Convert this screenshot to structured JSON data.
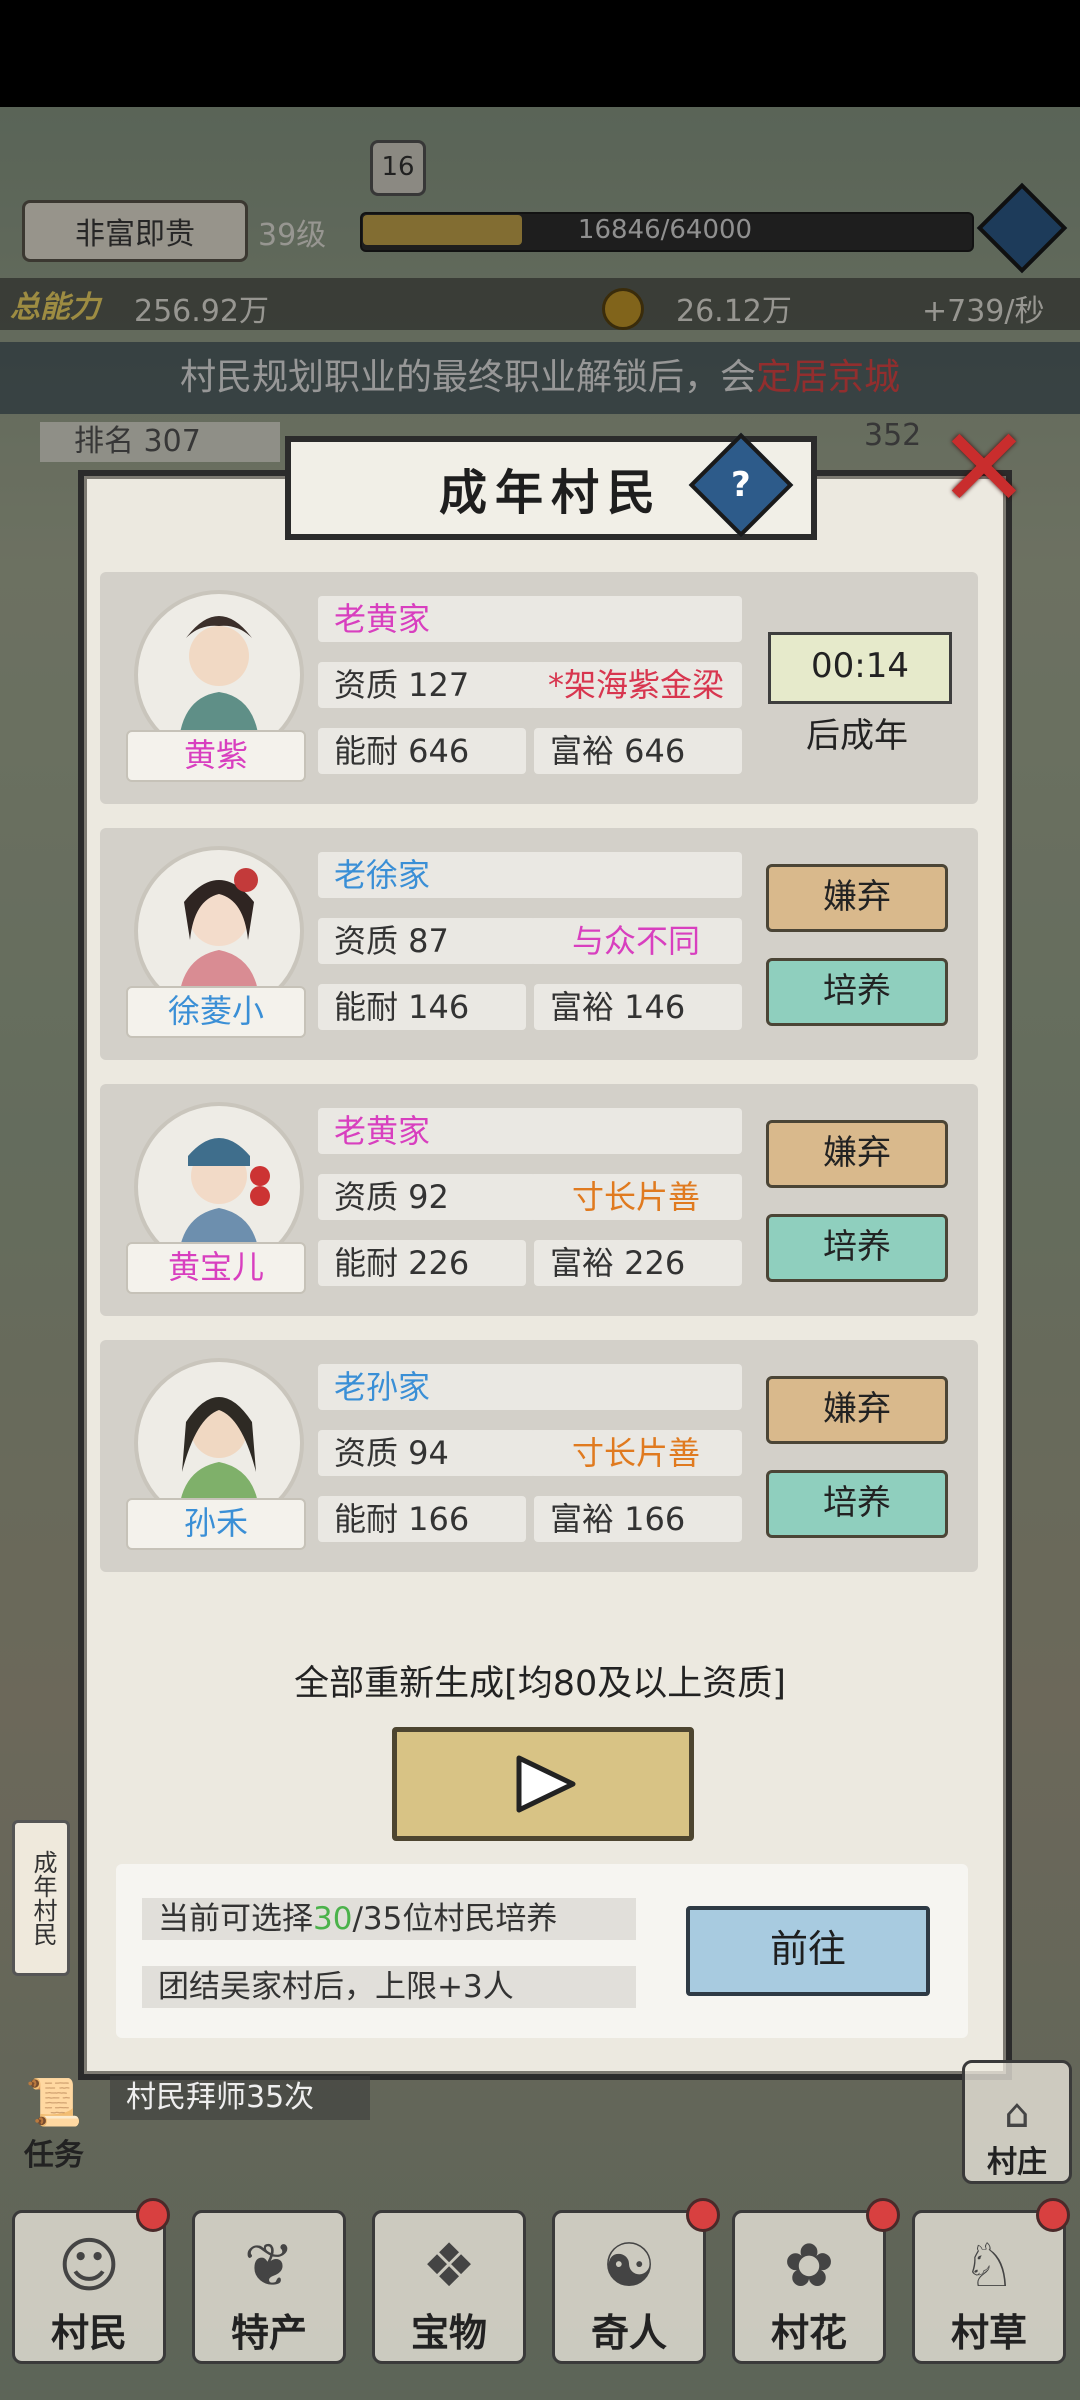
{
  "header": {
    "rank_title": "非富即贵",
    "level": "39级",
    "exp_text": "16846/64000",
    "exp_fraction": 0.263,
    "level_badge": "16",
    "assets_label": "总能力",
    "assets_value": "256.92万",
    "coins_value": "26.12万",
    "income_rate": "+739/秒",
    "rank_text": "排名 307",
    "rank_right": "352"
  },
  "notice": {
    "prefix": "村民规划职业的最终职业解锁后，会",
    "highlight": "定居京城"
  },
  "modal": {
    "title": "成年村民",
    "help_label": "?",
    "villagers": [
      {
        "family": "老黄家",
        "name": "黄紫",
        "aptitude": "资质 127",
        "trait": "*架海紫金梁",
        "ability": "能耐 646",
        "wealth": "富裕 646",
        "timer": "00:14",
        "timer_note": "后成年"
      },
      {
        "family": "老徐家",
        "name": "徐菱小",
        "aptitude": "资质 87",
        "trait": "与众不同",
        "ability": "能耐 146",
        "wealth": "富裕 146",
        "quit": "嫌弃",
        "train": "培养"
      },
      {
        "family": "老黄家",
        "name": "黄宝儿",
        "aptitude": "资质 92",
        "trait": "寸长片善",
        "ability": "能耐 226",
        "wealth": "富裕 226",
        "quit": "嫌弃",
        "train": "培养"
      },
      {
        "family": "老孙家",
        "name": "孙禾",
        "aptitude": "资质 94",
        "trait": "寸长片善",
        "ability": "能耐 166",
        "wealth": "富裕 166",
        "quit": "嫌弃",
        "train": "培养"
      }
    ],
    "regen_label": "全部重新生成[均80及以上资质]",
    "info_line1_prefix": "当前可选择",
    "info_line1_num": "30",
    "info_line1_suffix": "/35位村民培养",
    "info_line2": "团结吴家村后，上限+3人",
    "goto_label": "前往"
  },
  "side": {
    "left_tab": "成年村民",
    "task_label": "任务",
    "task_text": "村民拜师35次",
    "village_label": "村庄"
  },
  "bottom_nav": [
    "村民",
    "特产",
    "宝物",
    "奇人",
    "村花",
    "村草"
  ],
  "colors": {
    "trait_gold": "#d83fbf",
    "trait_purple": "#d83fbf",
    "trait_orange": "#e07a1f",
    "family_blue": "#3a8fd6"
  }
}
